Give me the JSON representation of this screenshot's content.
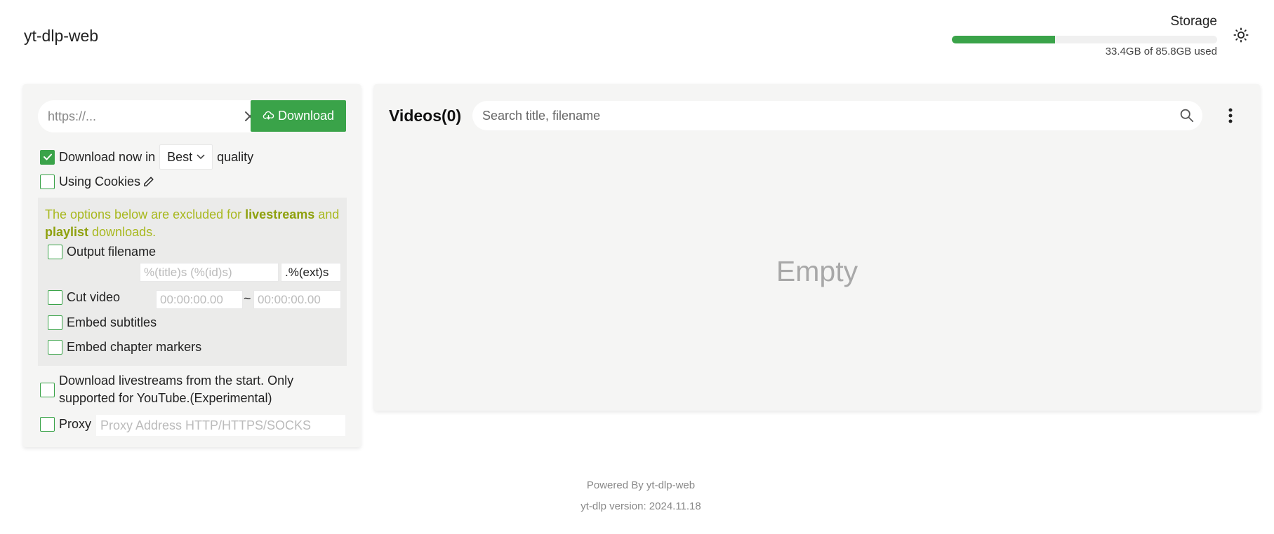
{
  "app": {
    "title": "yt-dlp-web"
  },
  "storage": {
    "label": "Storage",
    "used_text": "33.4GB of 85.8GB used",
    "used_fraction": 0.389,
    "bar_color": "#3aa349"
  },
  "header": {
    "theme_icon": "sun-icon"
  },
  "download_form": {
    "url_placeholder": "https://...",
    "url_value": "",
    "download_label": "Download",
    "download_now_label": "Download now in",
    "quality_value": "Best",
    "quality_suffix": "quality",
    "download_now_checked": true,
    "cookies_label": "Using Cookies",
    "options_note": {
      "part1": "The options below are excluded for ",
      "livestreams": "livestreams",
      "part2": " and ",
      "playlist": "playlist",
      "part3": " downloads."
    },
    "output_filename_label": "Output filename",
    "output_filename_placeholder": "%(title)s (%(id)s)",
    "output_ext_value": ".%(ext)s",
    "cut_video_label": "Cut video",
    "cut_start_placeholder": "00:00:00.00",
    "cut_end_placeholder": "00:00:00.00",
    "cut_separator": "~",
    "embed_subtitles_label": "Embed subtitles",
    "embed_chapters_label": "Embed chapter markers",
    "livestream_start_label_line1": "Download livestreams from the start. Only",
    "livestream_start_label_line2": "supported for YouTube.(Experimental)",
    "proxy_label": "Proxy",
    "proxy_placeholder": "Proxy Address HTTP/HTTPS/SOCKS"
  },
  "videos": {
    "title": "Videos(0)",
    "search_placeholder": "Search title, filename",
    "empty_text": "Empty"
  },
  "footer": {
    "powered_by": "Powered By yt-dlp-web",
    "version": "yt-dlp version: 2024.11.18"
  },
  "colors": {
    "accent": "#3aa349",
    "note": "#a8b81e",
    "panel_bg": "#f5f5f4"
  }
}
